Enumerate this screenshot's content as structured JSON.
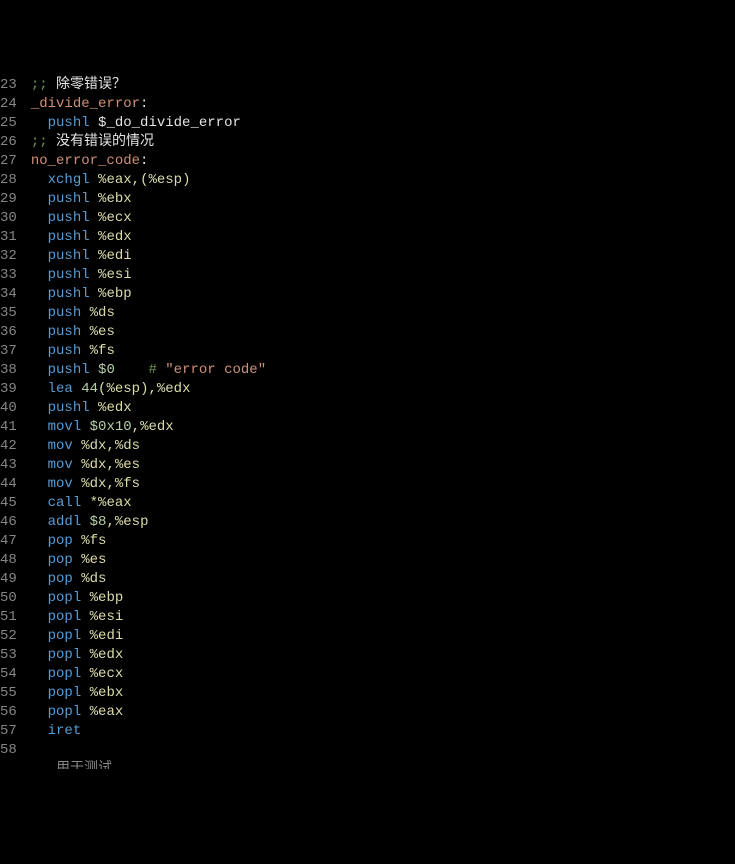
{
  "lines": [
    {
      "n": 23,
      "tokens": [
        {
          "t": ";; ",
          "c": "cm"
        },
        {
          "t": "除零错误？",
          "c": "cmtxt"
        }
      ]
    },
    {
      "n": 24,
      "tokens": [
        {
          "t": "_divide_error",
          "c": "lbl"
        },
        {
          "t": ":",
          "c": "sym"
        }
      ]
    },
    {
      "n": 25,
      "tokens": [
        {
          "t": "  ",
          "c": "indent"
        },
        {
          "t": "pushl ",
          "c": "mn"
        },
        {
          "t": "$_do_divide_error",
          "c": "sym"
        }
      ]
    },
    {
      "n": 26,
      "tokens": [
        {
          "t": ";; ",
          "c": "cm"
        },
        {
          "t": "没有错误的情况",
          "c": "cmtxt"
        }
      ]
    },
    {
      "n": 27,
      "tokens": [
        {
          "t": "no_error_code",
          "c": "lbl"
        },
        {
          "t": ":",
          "c": "sym"
        }
      ]
    },
    {
      "n": 28,
      "tokens": [
        {
          "t": "  ",
          "c": "indent"
        },
        {
          "t": "xchgl ",
          "c": "mn"
        },
        {
          "t": "%eax",
          "c": "reg"
        },
        {
          "t": ",",
          "c": "op"
        },
        {
          "t": "(",
          "c": "op"
        },
        {
          "t": "%esp",
          "c": "reg"
        },
        {
          "t": ")",
          "c": "op"
        }
      ]
    },
    {
      "n": 29,
      "tokens": [
        {
          "t": "  ",
          "c": "indent"
        },
        {
          "t": "pushl ",
          "c": "mn"
        },
        {
          "t": "%ebx",
          "c": "reg"
        }
      ]
    },
    {
      "n": 30,
      "tokens": [
        {
          "t": "  ",
          "c": "indent"
        },
        {
          "t": "pushl ",
          "c": "mn"
        },
        {
          "t": "%ecx",
          "c": "reg"
        }
      ]
    },
    {
      "n": 31,
      "tokens": [
        {
          "t": "  ",
          "c": "indent"
        },
        {
          "t": "pushl ",
          "c": "mn"
        },
        {
          "t": "%edx",
          "c": "reg"
        }
      ]
    },
    {
      "n": 32,
      "tokens": [
        {
          "t": "  ",
          "c": "indent"
        },
        {
          "t": "pushl ",
          "c": "mn"
        },
        {
          "t": "%edi",
          "c": "reg"
        }
      ]
    },
    {
      "n": 33,
      "tokens": [
        {
          "t": "  ",
          "c": "indent"
        },
        {
          "t": "pushl ",
          "c": "mn"
        },
        {
          "t": "%esi",
          "c": "reg"
        }
      ]
    },
    {
      "n": 34,
      "tokens": [
        {
          "t": "  ",
          "c": "indent"
        },
        {
          "t": "pushl ",
          "c": "mn"
        },
        {
          "t": "%ebp",
          "c": "reg"
        }
      ]
    },
    {
      "n": 35,
      "tokens": [
        {
          "t": "  ",
          "c": "indent"
        },
        {
          "t": "push ",
          "c": "mn"
        },
        {
          "t": "%ds",
          "c": "reg"
        }
      ]
    },
    {
      "n": 36,
      "tokens": [
        {
          "t": "  ",
          "c": "indent"
        },
        {
          "t": "push ",
          "c": "mn"
        },
        {
          "t": "%es",
          "c": "reg"
        }
      ]
    },
    {
      "n": 37,
      "tokens": [
        {
          "t": "  ",
          "c": "indent"
        },
        {
          "t": "push ",
          "c": "mn"
        },
        {
          "t": "%fs",
          "c": "reg"
        }
      ]
    },
    {
      "n": 38,
      "tokens": [
        {
          "t": "  ",
          "c": "indent"
        },
        {
          "t": "pushl ",
          "c": "mn"
        },
        {
          "t": "$0",
          "c": "imm"
        },
        {
          "t": "    ",
          "c": "indent"
        },
        {
          "t": "# ",
          "c": "cm"
        },
        {
          "t": "\"error code\"",
          "c": "str"
        }
      ]
    },
    {
      "n": 39,
      "tokens": [
        {
          "t": "  ",
          "c": "indent"
        },
        {
          "t": "lea ",
          "c": "mn"
        },
        {
          "t": "44",
          "c": "num"
        },
        {
          "t": "(",
          "c": "op"
        },
        {
          "t": "%esp",
          "c": "reg"
        },
        {
          "t": ")",
          "c": "op"
        },
        {
          "t": ",",
          "c": "op"
        },
        {
          "t": "%edx",
          "c": "reg"
        }
      ]
    },
    {
      "n": 40,
      "tokens": [
        {
          "t": "  ",
          "c": "indent"
        },
        {
          "t": "pushl ",
          "c": "mn"
        },
        {
          "t": "%edx",
          "c": "reg"
        }
      ]
    },
    {
      "n": 41,
      "tokens": [
        {
          "t": "  ",
          "c": "indent"
        },
        {
          "t": "movl ",
          "c": "mn"
        },
        {
          "t": "$0x10",
          "c": "imm"
        },
        {
          "t": ",",
          "c": "op"
        },
        {
          "t": "%edx",
          "c": "reg"
        }
      ]
    },
    {
      "n": 42,
      "tokens": [
        {
          "t": "  ",
          "c": "indent"
        },
        {
          "t": "mov ",
          "c": "mn"
        },
        {
          "t": "%dx",
          "c": "reg"
        },
        {
          "t": ",",
          "c": "op"
        },
        {
          "t": "%ds",
          "c": "reg"
        }
      ]
    },
    {
      "n": 43,
      "tokens": [
        {
          "t": "  ",
          "c": "indent"
        },
        {
          "t": "mov ",
          "c": "mn"
        },
        {
          "t": "%dx",
          "c": "reg"
        },
        {
          "t": ",",
          "c": "op"
        },
        {
          "t": "%es",
          "c": "reg"
        }
      ]
    },
    {
      "n": 44,
      "tokens": [
        {
          "t": "  ",
          "c": "indent"
        },
        {
          "t": "mov ",
          "c": "mn"
        },
        {
          "t": "%dx",
          "c": "reg"
        },
        {
          "t": ",",
          "c": "op"
        },
        {
          "t": "%fs",
          "c": "reg"
        }
      ]
    },
    {
      "n": 45,
      "tokens": [
        {
          "t": "  ",
          "c": "indent"
        },
        {
          "t": "call ",
          "c": "mn"
        },
        {
          "t": "*",
          "c": "op"
        },
        {
          "t": "%eax",
          "c": "reg"
        }
      ]
    },
    {
      "n": 46,
      "tokens": [
        {
          "t": "  ",
          "c": "indent"
        },
        {
          "t": "addl ",
          "c": "mn"
        },
        {
          "t": "$8",
          "c": "imm"
        },
        {
          "t": ",",
          "c": "op"
        },
        {
          "t": "%esp",
          "c": "reg"
        }
      ]
    },
    {
      "n": 47,
      "tokens": [
        {
          "t": "  ",
          "c": "indent"
        },
        {
          "t": "pop ",
          "c": "mn"
        },
        {
          "t": "%fs",
          "c": "reg"
        }
      ]
    },
    {
      "n": 48,
      "tokens": [
        {
          "t": "  ",
          "c": "indent"
        },
        {
          "t": "pop ",
          "c": "mn"
        },
        {
          "t": "%es",
          "c": "reg"
        }
      ]
    },
    {
      "n": 49,
      "tokens": [
        {
          "t": "  ",
          "c": "indent"
        },
        {
          "t": "pop ",
          "c": "mn"
        },
        {
          "t": "%ds",
          "c": "reg"
        }
      ]
    },
    {
      "n": 50,
      "tokens": [
        {
          "t": "  ",
          "c": "indent"
        },
        {
          "t": "popl ",
          "c": "mn"
        },
        {
          "t": "%ebp",
          "c": "reg"
        }
      ]
    },
    {
      "n": 51,
      "tokens": [
        {
          "t": "  ",
          "c": "indent"
        },
        {
          "t": "popl ",
          "c": "mn"
        },
        {
          "t": "%esi",
          "c": "reg"
        }
      ]
    },
    {
      "n": 52,
      "tokens": [
        {
          "t": "  ",
          "c": "indent"
        },
        {
          "t": "popl ",
          "c": "mn"
        },
        {
          "t": "%edi",
          "c": "reg"
        }
      ]
    },
    {
      "n": 53,
      "tokens": [
        {
          "t": "  ",
          "c": "indent"
        },
        {
          "t": "popl ",
          "c": "mn"
        },
        {
          "t": "%edx",
          "c": "reg"
        }
      ]
    },
    {
      "n": 54,
      "tokens": [
        {
          "t": "  ",
          "c": "indent"
        },
        {
          "t": "popl ",
          "c": "mn"
        },
        {
          "t": "%ecx",
          "c": "reg"
        }
      ]
    },
    {
      "n": 55,
      "tokens": [
        {
          "t": "  ",
          "c": "indent"
        },
        {
          "t": "popl ",
          "c": "mn"
        },
        {
          "t": "%ebx",
          "c": "reg"
        }
      ]
    },
    {
      "n": 56,
      "tokens": [
        {
          "t": "  ",
          "c": "indent"
        },
        {
          "t": "popl ",
          "c": "mn"
        },
        {
          "t": "%eax",
          "c": "reg"
        }
      ]
    },
    {
      "n": 57,
      "tokens": [
        {
          "t": "  ",
          "c": "indent"
        },
        {
          "t": "iret",
          "c": "mn"
        }
      ]
    },
    {
      "n": 58,
      "tokens": [
        {
          "t": " ",
          "c": "indent"
        }
      ]
    }
  ],
  "cutoff": "    用于测试"
}
